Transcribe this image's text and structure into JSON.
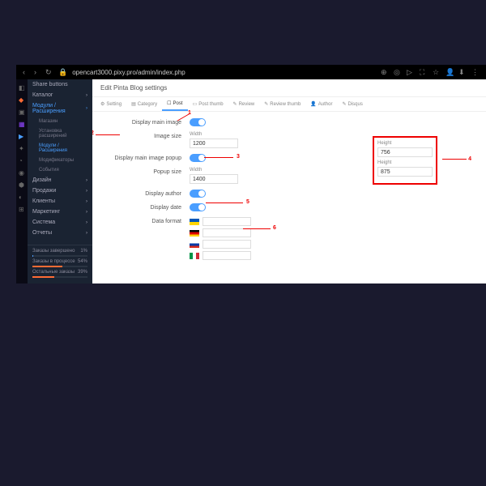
{
  "url": "opencart3000.pixy.pro/admin/index.php",
  "page_title": "Edit Pinta Blog settings",
  "sidebar": {
    "share": "Share buttons",
    "catalog": "Каталог",
    "modules": "Модули / Расширения",
    "sub": {
      "store": "Магазин",
      "installer": "Установка расширений",
      "modules2": "Модули / Расширения",
      "modifications": "Модификаторы",
      "events": "События"
    },
    "design": "Дизайн",
    "sales": "Продажи",
    "customers": "Клиенты",
    "marketing": "Маркетинг",
    "system": "Система",
    "reports": "Отчеты"
  },
  "stats": {
    "s1": {
      "label": "Заказы завершено",
      "val": "1%"
    },
    "s2": {
      "label": "Заказы в процессе",
      "val": "54%"
    },
    "s3": {
      "label": "Остальные заказы",
      "val": "39%"
    }
  },
  "tabs": {
    "setting": "Setting",
    "category": "Category",
    "post": "Post",
    "post_thumb": "Post thumb",
    "review": "Review",
    "review_thumb": "Review thumb",
    "author": "Author",
    "disqus": "Disqus"
  },
  "form": {
    "display_main_image": "Display main image",
    "image_size": "Image size",
    "display_main_image_popup": "Display main image popup",
    "popup_size": "Popup size",
    "display_author": "Display author",
    "display_date": "Display date",
    "data_format": "Data format",
    "width": "Width",
    "height": "Height",
    "width1_val": "1200",
    "height1_val": "756",
    "width2_val": "1400",
    "height2_val": "875"
  },
  "annotations": {
    "a1": "1",
    "a2": "2",
    "a3": "3",
    "a4": "4",
    "a5": "5",
    "a6": "6"
  }
}
